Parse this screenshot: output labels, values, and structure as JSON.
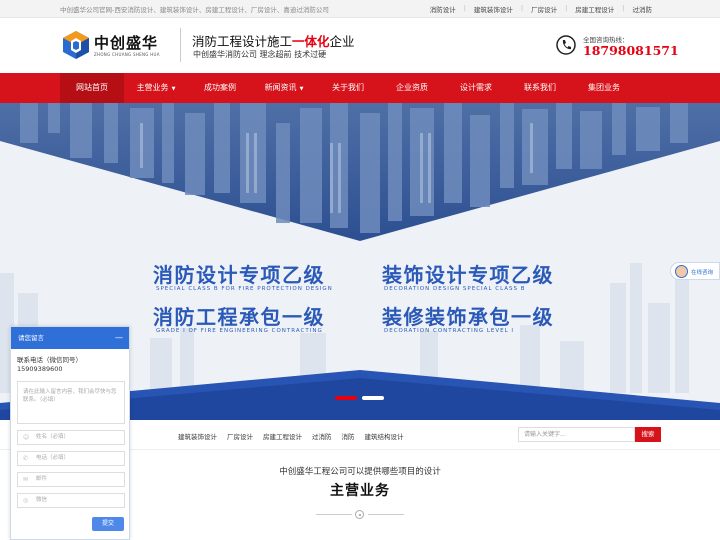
{
  "topbar": {
    "intro": "中创盛华公司官网-西安消防设计、建筑装饰设计、房建工程设计、厂房设计、喜迪过消防公司",
    "links": [
      "消防设计",
      "建筑装饰设计",
      "厂房设计",
      "房建工程设计",
      "过消防"
    ]
  },
  "header": {
    "brand": "中创盛华",
    "brand_en": "ZHONG CHUANG SHENG HUA",
    "slogan_pre": "消防工程设计施工",
    "slogan_highlight": "一体化",
    "slogan_post": "企业",
    "slogan_sub": "中创盛华消防公司 理念超前 技术过硬",
    "hotline_label": "全国咨询热线：",
    "hotline": "18798081571",
    "icons": {
      "logo": "cube-logo-icon",
      "phone": "phone-icon"
    }
  },
  "nav": {
    "items": [
      {
        "label": "网站首页",
        "caret": ""
      },
      {
        "label": "主营业务",
        "caret": "▼"
      },
      {
        "label": "成功案例",
        "caret": ""
      },
      {
        "label": "新闻资讯",
        "caret": "▼"
      },
      {
        "label": "关于我们",
        "caret": ""
      },
      {
        "label": "企业资质",
        "caret": ""
      },
      {
        "label": "设计需求",
        "caret": ""
      },
      {
        "label": "联系我们",
        "caret": ""
      },
      {
        "label": "集团业务",
        "caret": ""
      }
    ],
    "active_index": 0
  },
  "banner": {
    "lines": [
      {
        "cn": "消防设计专项乙级",
        "en": "SPECIAL CLASS B FOR FIRE PROTECTION DESIGN"
      },
      {
        "cn": "装饰设计专项乙级",
        "en": "DECORATION DESIGN SPECIAL CLASS B"
      },
      {
        "cn": "消防工程承包一级",
        "en": "GRADE I OF FIRE ENGINEERING CONTRACTING"
      },
      {
        "cn": "装修装饰承包一级",
        "en": "DECORATION CONTRACTING LEVEL I"
      }
    ],
    "slide_count": 2,
    "active_slide": 0,
    "online_label": "在线咨询"
  },
  "search": {
    "hot_links": [
      "建筑装饰设计",
      "厂房设计",
      "房建工程设计",
      "过消防",
      "消防",
      "建筑结构设计"
    ],
    "placeholder": "请输入关键字...",
    "button": "搜索"
  },
  "section": {
    "subtitle": "中创盛华工程公司可以提供哪些项目的设计",
    "title": "主营业务"
  },
  "message_panel": {
    "title": "请您留言",
    "minimize": "—",
    "contact_line1": "联系电话（微信同号）",
    "contact_line2": "15909389600",
    "textarea_placeholder": "请在此输入留言内容，我们会尽快与您联系。（必填）",
    "fields": [
      {
        "placeholder": "姓名（必填）",
        "icon": "user-icon"
      },
      {
        "placeholder": "电话（必填）",
        "icon": "phone-icon"
      },
      {
        "placeholder": "邮件",
        "icon": "mail-icon"
      },
      {
        "placeholder": "微信",
        "icon": "wechat-icon"
      }
    ],
    "submit": "提交"
  }
}
